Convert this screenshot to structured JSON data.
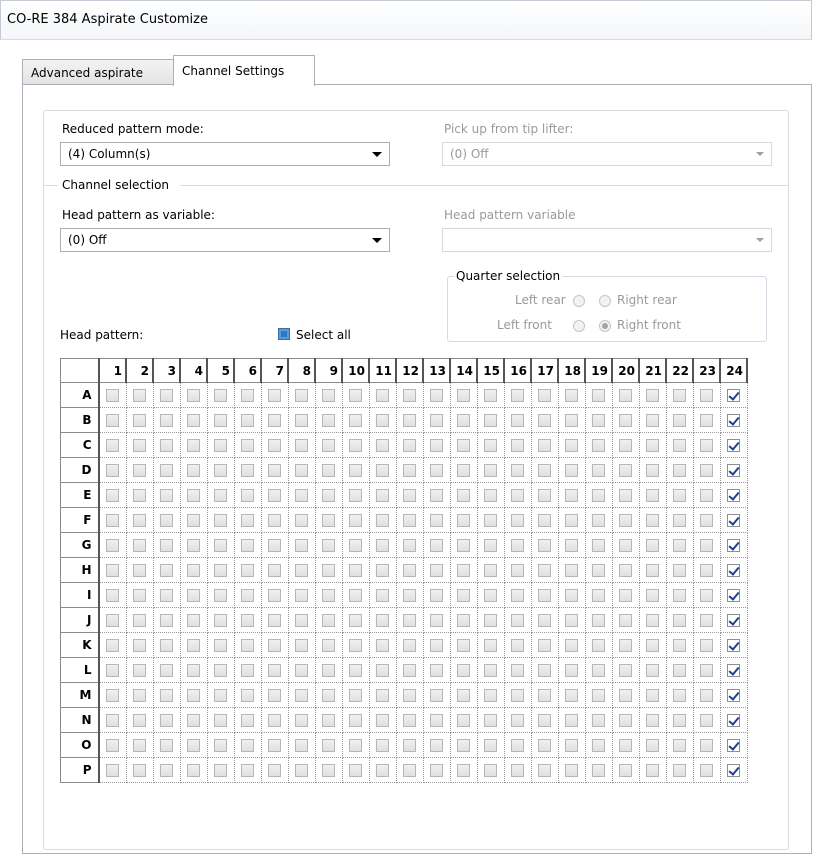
{
  "window": {
    "title": "CO-RE 384 Aspirate Customize"
  },
  "tabs": [
    {
      "label": "Advanced aspirate",
      "active": false
    },
    {
      "label": "Channel Settings",
      "active": true
    }
  ],
  "reduced_pattern": {
    "label": "Reduced pattern mode:",
    "value": "(4) Column(s)"
  },
  "tip_lifter": {
    "label": "Pick up from tip lifter:",
    "value": "(0) Off",
    "disabled": true
  },
  "channel_selection": {
    "label": "Channel selection"
  },
  "head_pattern_var": {
    "label": "Head pattern as variable:",
    "value": "(0) Off"
  },
  "head_pattern_variable": {
    "label": "Head pattern variable",
    "value": "",
    "disabled": true
  },
  "quarter": {
    "label": "Quarter selection",
    "left_rear": "Left rear",
    "right_rear": "Right rear",
    "left_front": "Left front",
    "right_front": "Right front",
    "selected": "right_front"
  },
  "head_pattern": {
    "label": "Head pattern:",
    "select_all": "Select all",
    "columns": [
      "1",
      "2",
      "3",
      "4",
      "5",
      "6",
      "7",
      "8",
      "9",
      "10",
      "11",
      "12",
      "13",
      "14",
      "15",
      "16",
      "17",
      "18",
      "19",
      "20",
      "21",
      "22",
      "23",
      "24"
    ],
    "rows": [
      "A",
      "B",
      "C",
      "D",
      "E",
      "F",
      "G",
      "H",
      "I",
      "J",
      "K",
      "L",
      "M",
      "N",
      "O",
      "P"
    ],
    "checked_columns": [
      "24"
    ]
  }
}
